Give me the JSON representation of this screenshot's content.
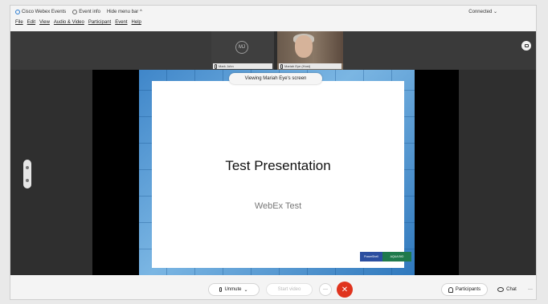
{
  "titlebar": {
    "app_name": "Cisco Webex Events",
    "event_info": "Event info",
    "hide_menu_bar": "Hide menu bar ^",
    "connection_status": "Connected ⌄"
  },
  "menubar": {
    "items": [
      "File",
      "Edit",
      "View",
      "Audio & Video",
      "Participant",
      "Event",
      "Help"
    ]
  },
  "video_strip": {
    "tile1": {
      "avatar_initials": "MJ",
      "name": "Mark John"
    },
    "tile2": {
      "name": "Mariah Eye (Host)"
    }
  },
  "share": {
    "viewing_label": "Viewing Mariah Eye's screen"
  },
  "slide": {
    "title": "Test Presentation",
    "subtitle": "WebEx Test",
    "logo_left": "PowerShell",
    "logo_right": "AQUA BIO"
  },
  "controls": {
    "unmute": "Unmute",
    "video": "Start video",
    "more": "···",
    "end": "✕",
    "participants": "Participants",
    "chat": "Chat",
    "right_more": "···"
  }
}
